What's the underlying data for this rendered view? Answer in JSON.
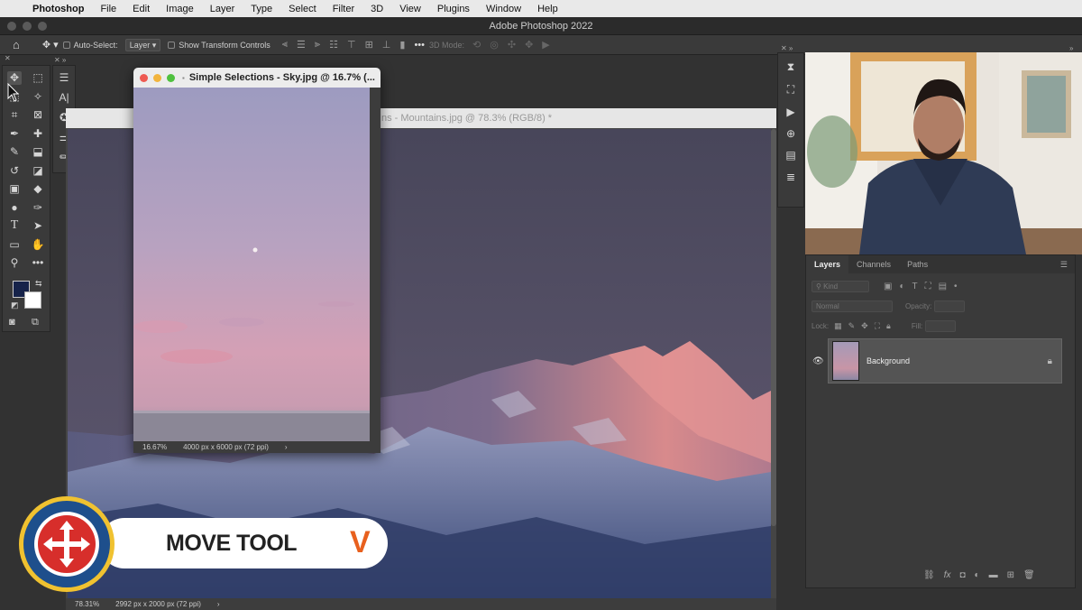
{
  "menubar": {
    "app": "Photoshop",
    "items": [
      "File",
      "Edit",
      "Image",
      "Layer",
      "Type",
      "Select",
      "Filter",
      "3D",
      "View",
      "Plugins",
      "Window",
      "Help"
    ]
  },
  "window_title": "Adobe Photoshop 2022",
  "options_bar": {
    "auto_select_label": "Auto-Select:",
    "auto_select_value": "Layer",
    "transform_label": "Show Transform Controls",
    "mode_3d_label": "3D Mode:"
  },
  "documents": {
    "sky": {
      "tab": "Simple Selections - Sky.jpg @ 16.7% (...",
      "zoom": "16.67%",
      "size": "4000 px x 6000 px (72 ppi)"
    },
    "mountains": {
      "tab": "ns - Mountains.jpg @ 78.3% (RGB/8) *",
      "zoom": "78.31%",
      "size": "2992 px x 2000 px (72 ppi)"
    }
  },
  "layers_panel": {
    "tabs": [
      "Layers",
      "Channels",
      "Paths"
    ],
    "kind_placeholder": "Kind",
    "blend_mode": "Normal",
    "opacity_label": "Opacity:",
    "lock_label": "Lock:",
    "fill_label": "Fill:",
    "layer_name": "Background"
  },
  "lower_third": {
    "title": "MOVE TOOL",
    "shortcut": "V",
    "accent": "#e8601e",
    "badge_ring": "#f0c230",
    "badge_blue": "#1e4f8c",
    "badge_red": "#d72e2b"
  },
  "colors": {
    "foreground": "#16234a",
    "background": "#ffffff"
  }
}
